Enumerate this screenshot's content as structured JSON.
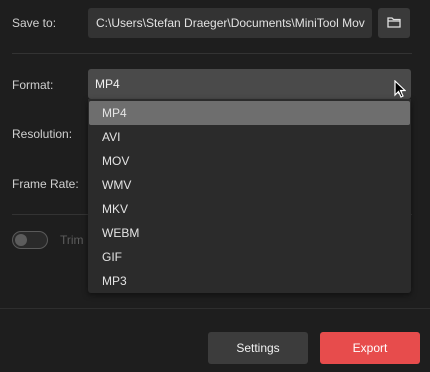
{
  "save": {
    "label": "Save to:",
    "path": "C:\\Users\\Stefan Draeger\\Documents\\MiniTool Mov"
  },
  "format": {
    "label": "Format:",
    "selected": "MP4",
    "options": [
      "MP4",
      "AVI",
      "MOV",
      "WMV",
      "MKV",
      "WEBM",
      "GIF",
      "MP3"
    ]
  },
  "resolution": {
    "label": "Resolution:"
  },
  "frame_rate": {
    "label": "Frame Rate:"
  },
  "trim": {
    "label": "Trim",
    "enabled": false
  },
  "buttons": {
    "settings": "Settings",
    "export": "Export"
  },
  "colors": {
    "background": "#1e1e1e",
    "accent_export": "#e74c4c",
    "selected_option": "#6e6e6e"
  },
  "icons": {
    "folder": "folder-icon",
    "chevron": "chevron-down-icon",
    "cursor": "mouse-cursor-icon"
  }
}
